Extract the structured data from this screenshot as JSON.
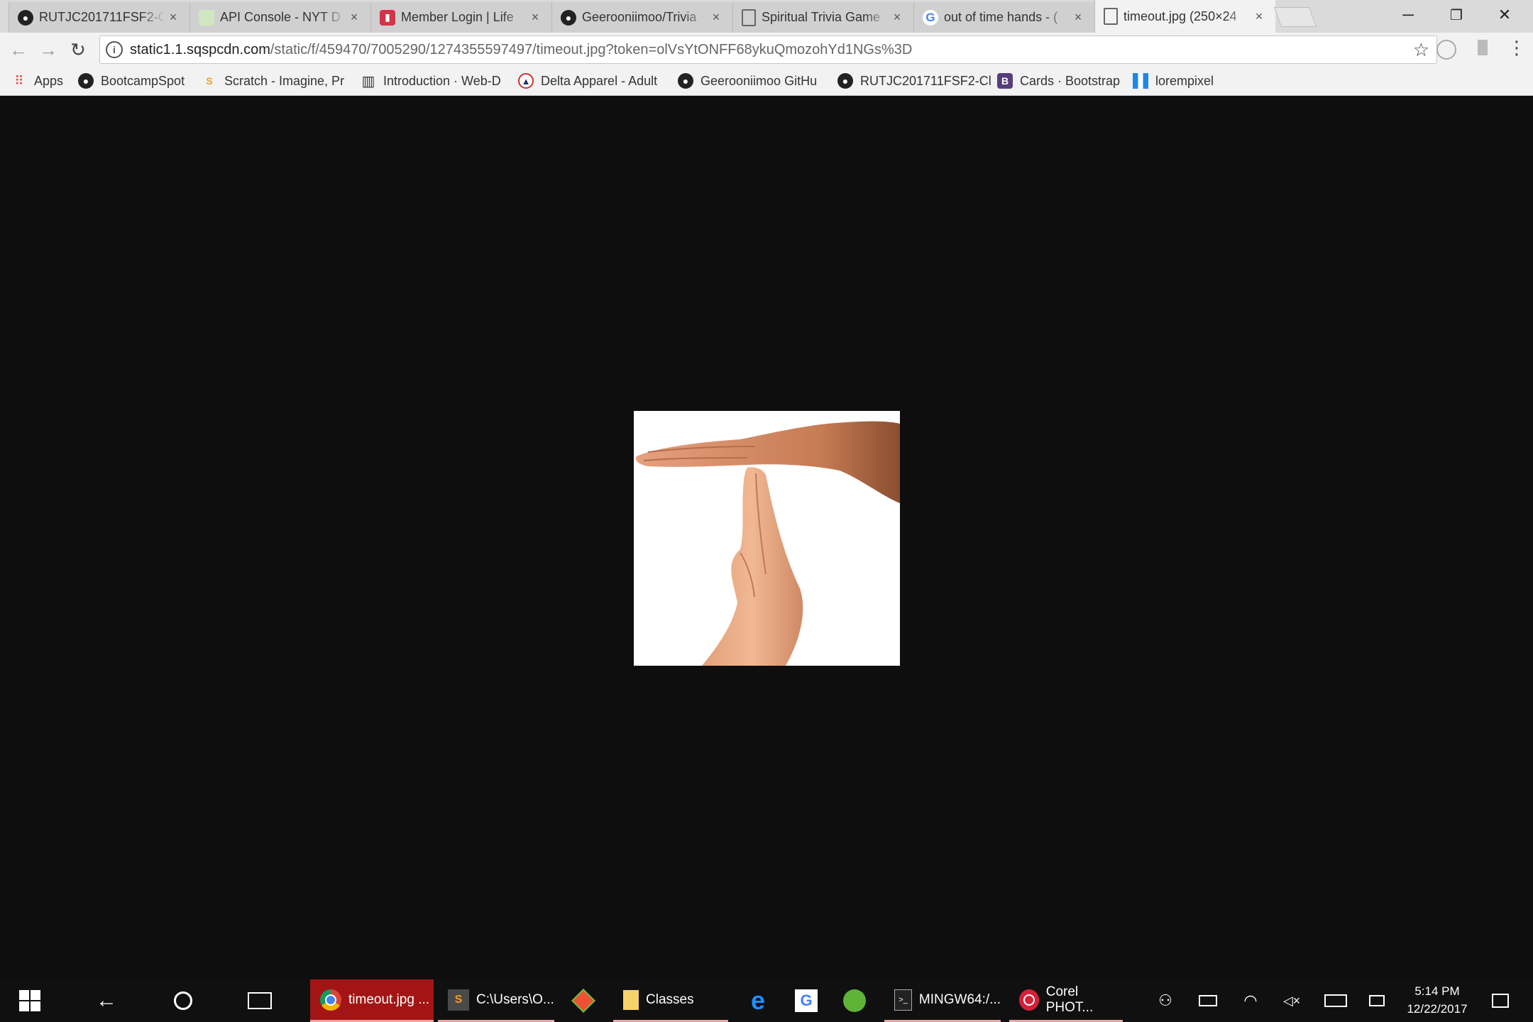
{
  "browser": {
    "tabs": [
      {
        "title": "RUTJC201711FSF2-C",
        "icon": "github-icon",
        "active": false
      },
      {
        "title": "API Console - NYT D",
        "icon": "page-icon",
        "active": false
      },
      {
        "title": "Member Login | Life",
        "icon": "lock-icon",
        "active": false
      },
      {
        "title": "Geerooniimoo/Trivia",
        "icon": "github-icon",
        "active": false
      },
      {
        "title": "Spiritual Trivia Game",
        "icon": "page-icon",
        "active": false
      },
      {
        "title": "out of time hands - (",
        "icon": "google-icon",
        "active": false
      },
      {
        "title": "timeout.jpg (250×24",
        "icon": "page-icon",
        "active": true
      }
    ],
    "tab_close": "×",
    "window_controls": {
      "minimize": "─",
      "restore": "❐",
      "close": "✕"
    },
    "address": {
      "host": "static1.1.sqspcdn.com",
      "path": "/static/f/459470/7005290/1274355597497/timeout.jpg?token=olVsYtONFF68ykuQmozohYd1NGs%3D"
    },
    "bookmarks": [
      {
        "label": "Apps",
        "icon": "apps-grid-icon"
      },
      {
        "label": "BootcampSpot",
        "icon": "github-icon"
      },
      {
        "label": "Scratch - Imagine, Pr",
        "icon": "scratch-icon"
      },
      {
        "label": "Introduction · Web-D",
        "icon": "book-icon"
      },
      {
        "label": "Delta Apparel - Adult",
        "icon": "delta-icon"
      },
      {
        "label": "Geerooniimoo GitHu",
        "icon": "github-icon"
      },
      {
        "label": "RUTJC201711FSF2-Cl",
        "icon": "github-icon"
      },
      {
        "label": "Cards · Bootstrap",
        "icon": "bootstrap-icon"
      },
      {
        "label": "lorempixel",
        "icon": "lorempixel-icon"
      }
    ]
  },
  "content": {
    "image_alt": "timeout.jpg"
  },
  "taskbar": {
    "apps": [
      {
        "label": "timeout.jpg ...",
        "icon": "chrome-icon"
      },
      {
        "label": "C:\\Users\\O...",
        "icon": "sublime-icon"
      },
      {
        "label": "Classes",
        "icon": "folder-icon"
      },
      {
        "label": "MINGW64:/...",
        "icon": "terminal-icon"
      },
      {
        "label": "Corel PHOT...",
        "icon": "corel-icon"
      }
    ],
    "clock": {
      "time": "5:14 PM",
      "date": "12/22/2017"
    }
  },
  "colors": {
    "active_app_bg": "#a31515",
    "taskbar": "#101010",
    "page_bg": "#0e0e0e"
  }
}
